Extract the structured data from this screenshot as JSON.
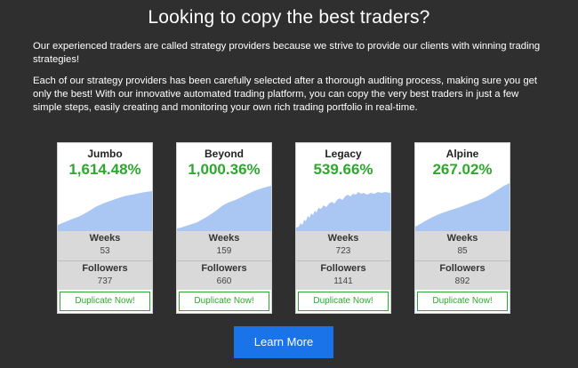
{
  "title": "Looking to copy the best traders?",
  "paragraphs": {
    "p1": "Our experienced traders are called strategy providers because we strive to provide our clients with winning trading strategies!",
    "p2": "Each of our strategy providers has been carefully selected after a thorough auditing process, making sure you get only the best! With our innovative automated trading platform, you can copy the very best traders in just a few simple steps, easily creating and monitoring your own rich trading portfolio in real-time."
  },
  "labels": {
    "weeks": "Weeks",
    "followers": "Followers",
    "duplicate": "Duplicate Now!"
  },
  "colors": {
    "accent_green": "#2ea82e",
    "chart_fill": "#a9c7f2",
    "button_blue": "#1a73e8"
  },
  "providers": [
    {
      "name": "Jumbo",
      "return": "1,614.48%",
      "weeks": "53",
      "followers": "737"
    },
    {
      "name": "Beyond",
      "return": "1,000.36%",
      "weeks": "159",
      "followers": "660"
    },
    {
      "name": "Legacy",
      "return": "539.66%",
      "weeks": "723",
      "followers": "1141"
    },
    {
      "name": "Alpine",
      "return": "267.02%",
      "weeks": "85",
      "followers": "892"
    }
  ],
  "cta": {
    "learn_more": "Learn More"
  }
}
